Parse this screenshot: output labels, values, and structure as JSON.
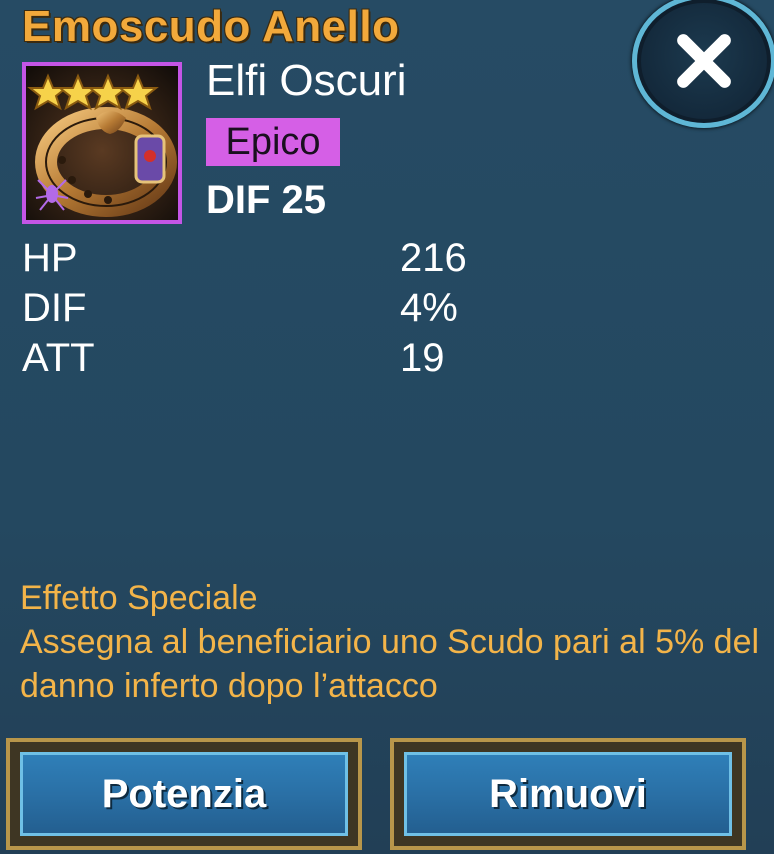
{
  "header": {
    "title": "Emoscudo Anello"
  },
  "item": {
    "faction": "Elfi Oscuri",
    "rarity": "Epico",
    "main_stat": "DIF 25",
    "stars": 4,
    "icon": "golden-ring-icon",
    "faction_icon": "spider-icon"
  },
  "stats": [
    {
      "name": "HP",
      "value": "216"
    },
    {
      "name": "DIF",
      "value": "4%"
    },
    {
      "name": "ATT",
      "value": "19"
    }
  ],
  "effect": {
    "title": "Effetto Speciale",
    "description": "Assegna al beneficiario uno Scudo pari al 5% del danno inferto dopo l’attacco"
  },
  "buttons": {
    "upgrade": "Potenzia",
    "remove": "Rimuovi"
  },
  "colors": {
    "title": "#f2a93b",
    "rarity_epic": "#d55fe6",
    "effect_text": "#f3b449",
    "panel": "#24475f",
    "button": "#2f7fb8"
  }
}
